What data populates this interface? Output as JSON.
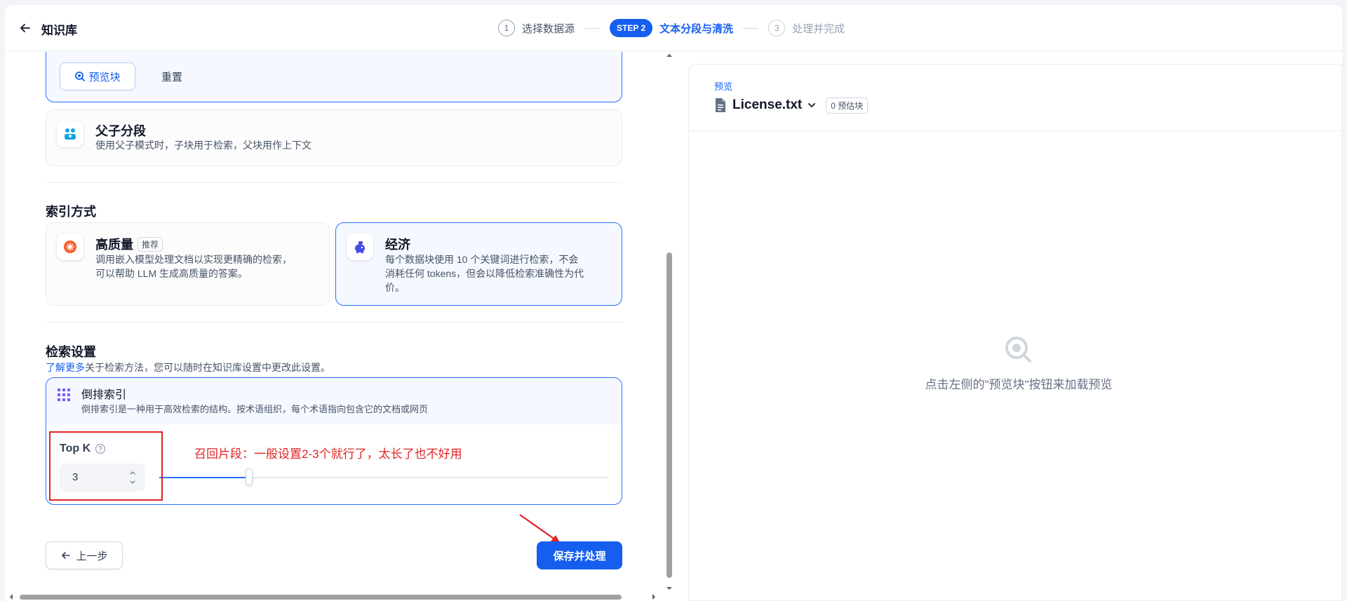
{
  "header": {
    "title": "知识库",
    "steps": [
      {
        "num": "1",
        "label": "选择数据源"
      },
      {
        "badge": "STEP 2",
        "label": "文本分段与清洗"
      },
      {
        "num": "3",
        "label": "处理并完成"
      }
    ]
  },
  "segment": {
    "preview_button": "预览块",
    "reset_button": "重置",
    "parent_child_title": "父子分段",
    "parent_child_desc": "使用父子模式时，子块用于检索，父块用作上下文"
  },
  "index": {
    "section_title": "索引方式",
    "high_quality_title": "高质量",
    "high_quality_badge": "推荐",
    "high_quality_desc_1": "调用嵌入模型处理文档以实现更精确的检索，",
    "high_quality_desc_2": "可以帮助 LLM 生成高质量的答案。",
    "economy_title": "经济",
    "economy_desc_1": "每个数据块使用 10 个关键词进行检索，不会",
    "economy_desc_2": "消耗任何 tokens，但会以降低检索准确性为代",
    "economy_desc_3": "价。"
  },
  "retrieval": {
    "section_title": "检索设置",
    "learn_more": "了解更多",
    "desc": "关于检索方法，您可以随时在知识库设置中更改此设置。",
    "method_title": "倒排索引",
    "method_desc": "倒排索引是一种用于高效检索的结构。按术语组织，每个术语指向包含它的文档或网页",
    "topk_label": "Top K",
    "topk_value": "3",
    "slider_level": 0.2,
    "annotation": "召回片段：一般设置2-3个就行了，太长了也不好用"
  },
  "footer": {
    "prev_button": "上一步",
    "save_button": "保存并处理"
  },
  "preview": {
    "label": "预览",
    "file_name": "License.txt",
    "chunk_count": "0 预估块",
    "empty_text": "点击左侧的\"预览块\"按钮来加载预览"
  },
  "colors": {
    "primary": "#155eef",
    "annotation": "#e02424",
    "border": "#eaecf0"
  },
  "icons": [
    "back-arrow-icon",
    "search-preview-icon",
    "parent-child-icon",
    "high-quality-icon",
    "economy-icon",
    "inverted-index-icon",
    "help-circle-icon",
    "arrow-left-icon",
    "document-icon",
    "chevron-down-icon",
    "search-empty-icon"
  ]
}
